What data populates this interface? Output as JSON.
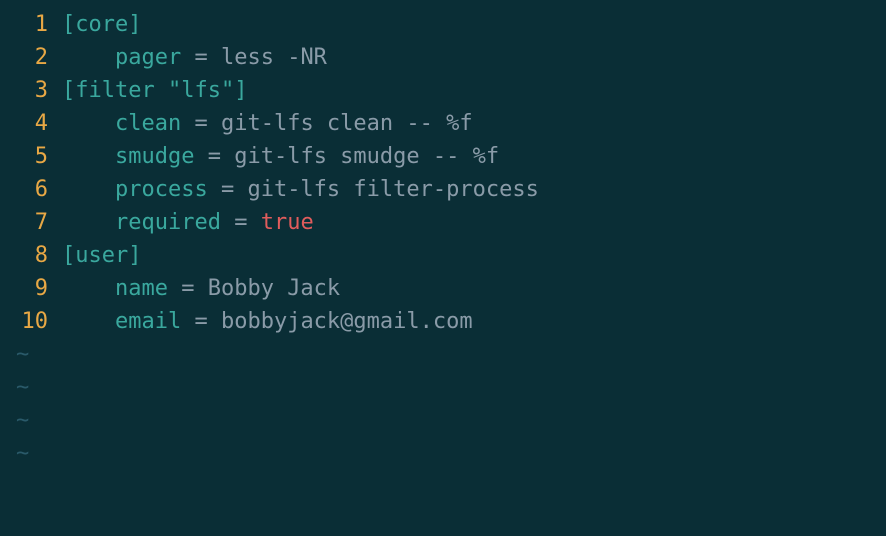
{
  "lines": [
    {
      "n": "1",
      "parts": [
        {
          "t": "[core]",
          "c": "section-bracket"
        }
      ]
    },
    {
      "n": "2",
      "parts": [
        {
          "t": "    ",
          "c": "value"
        },
        {
          "t": "pager",
          "c": "key"
        },
        {
          "t": " = ",
          "c": "equals"
        },
        {
          "t": "less -NR",
          "c": "value"
        }
      ]
    },
    {
      "n": "3",
      "parts": [
        {
          "t": "[filter ",
          "c": "section-bracket"
        },
        {
          "t": "\"lfs\"",
          "c": "section-string"
        },
        {
          "t": "]",
          "c": "section-bracket"
        }
      ]
    },
    {
      "n": "4",
      "parts": [
        {
          "t": "    ",
          "c": "value"
        },
        {
          "t": "clean",
          "c": "key"
        },
        {
          "t": " = ",
          "c": "equals"
        },
        {
          "t": "git-lfs clean -- %f",
          "c": "value"
        }
      ]
    },
    {
      "n": "5",
      "parts": [
        {
          "t": "    ",
          "c": "value"
        },
        {
          "t": "smudge",
          "c": "key"
        },
        {
          "t": " = ",
          "c": "equals"
        },
        {
          "t": "git-lfs smudge -- %f",
          "c": "value"
        }
      ]
    },
    {
      "n": "6",
      "parts": [
        {
          "t": "    ",
          "c": "value"
        },
        {
          "t": "process",
          "c": "key"
        },
        {
          "t": " = ",
          "c": "equals"
        },
        {
          "t": "git-lfs filter-process",
          "c": "value"
        }
      ]
    },
    {
      "n": "7",
      "parts": [
        {
          "t": "    ",
          "c": "value"
        },
        {
          "t": "required",
          "c": "key"
        },
        {
          "t": " = ",
          "c": "equals"
        },
        {
          "t": "true",
          "c": "bool-true"
        }
      ]
    },
    {
      "n": "8",
      "parts": [
        {
          "t": "[user]",
          "c": "section-bracket"
        }
      ]
    },
    {
      "n": "9",
      "parts": [
        {
          "t": "    ",
          "c": "value"
        },
        {
          "t": "name",
          "c": "key"
        },
        {
          "t": " = ",
          "c": "equals"
        },
        {
          "t": "Bobby Jack",
          "c": "value"
        }
      ]
    },
    {
      "n": "10",
      "parts": [
        {
          "t": "    ",
          "c": "value"
        },
        {
          "t": "email",
          "c": "key"
        },
        {
          "t": " = ",
          "c": "equals"
        },
        {
          "t": "bobbyjack@gmail.com",
          "c": "value"
        }
      ]
    }
  ],
  "tilde": "~",
  "tilde_count": 4
}
